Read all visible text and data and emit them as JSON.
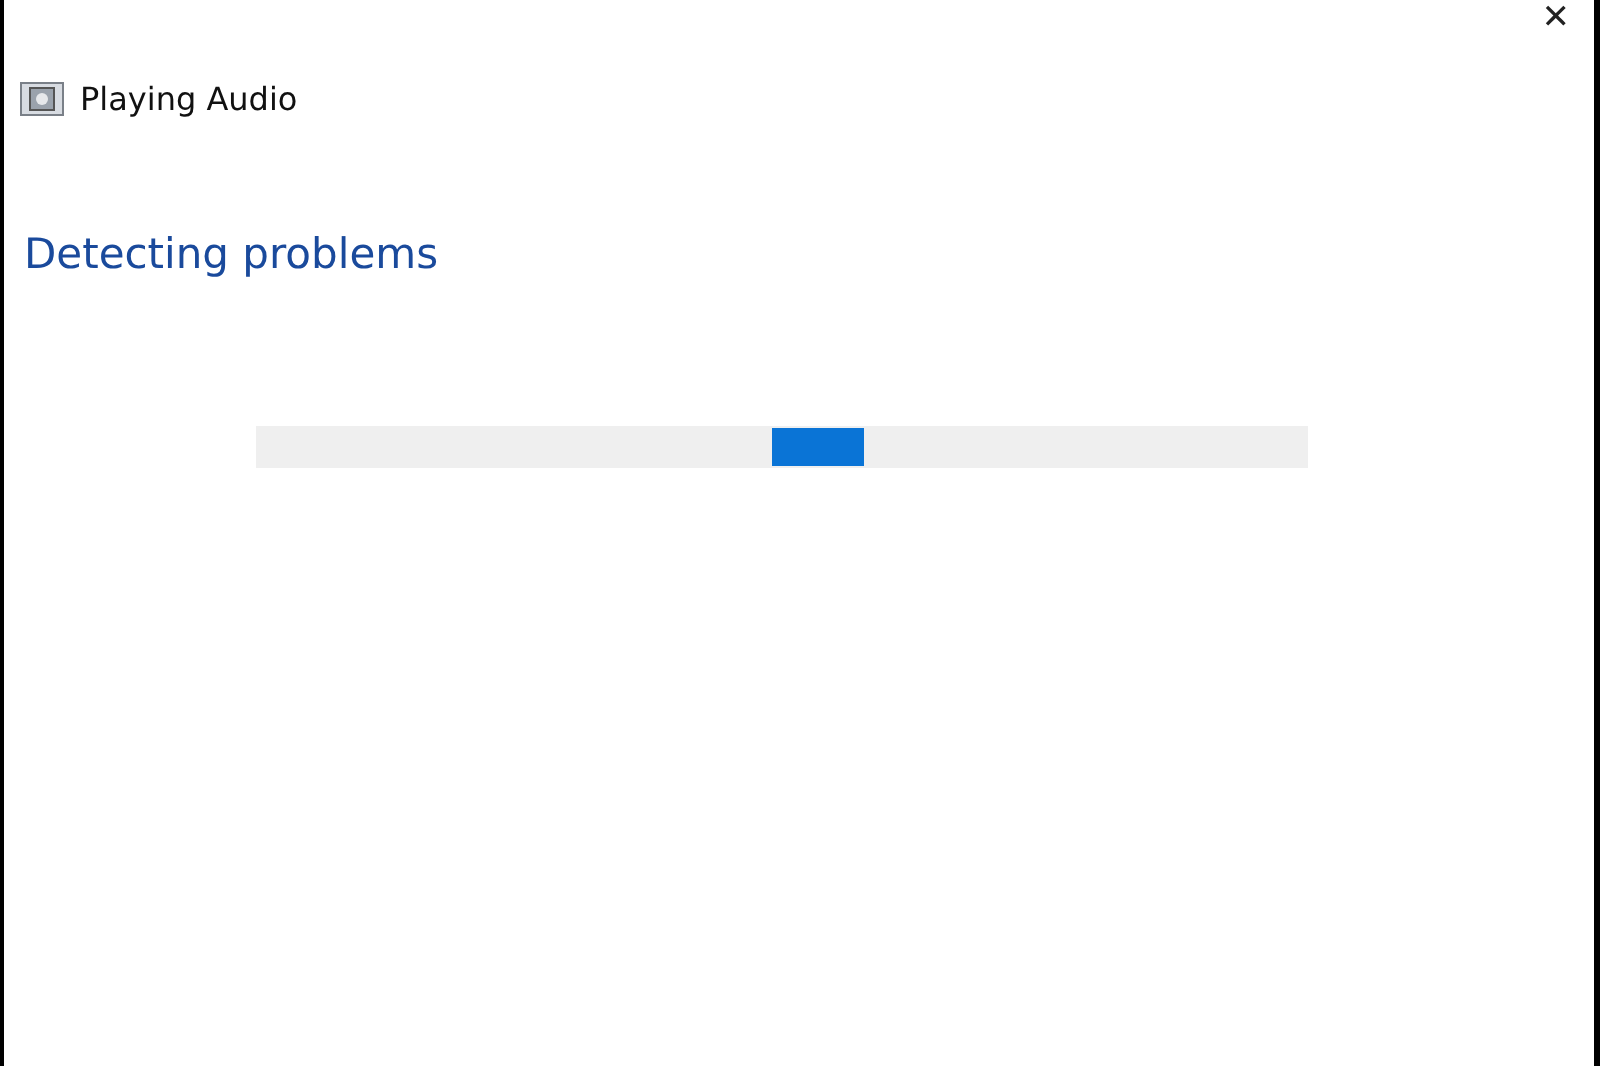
{
  "window": {
    "title": "Playing Audio",
    "close": "✕"
  },
  "heading": "Detecting problems",
  "progress": {
    "kind": "indeterminate"
  }
}
